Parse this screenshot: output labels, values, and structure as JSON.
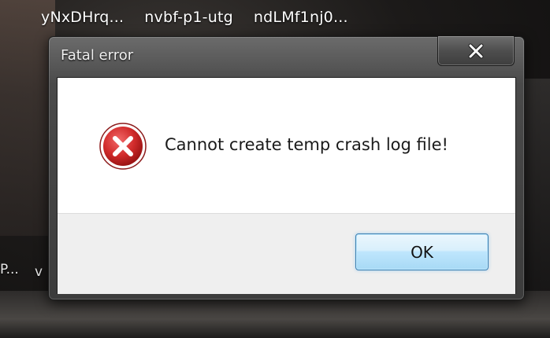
{
  "taskbar": {
    "items": [
      {
        "label": "yNxDHrq..."
      },
      {
        "label": "nvbf-p1-utg"
      },
      {
        "label": "ndLMf1nj0..."
      }
    ]
  },
  "desktop": {
    "fragment_1": "P...",
    "fragment_2": "v"
  },
  "dialog": {
    "title": "Fatal error",
    "close_icon": "close-x-icon",
    "error_icon": "error-circle-x-icon",
    "message": "Cannot create temp crash log file!",
    "ok_label": "OK",
    "colors": {
      "error_red": "#c4262b",
      "ok_border": "#3c7fb1",
      "ok_fill": "#bee6fd"
    }
  }
}
